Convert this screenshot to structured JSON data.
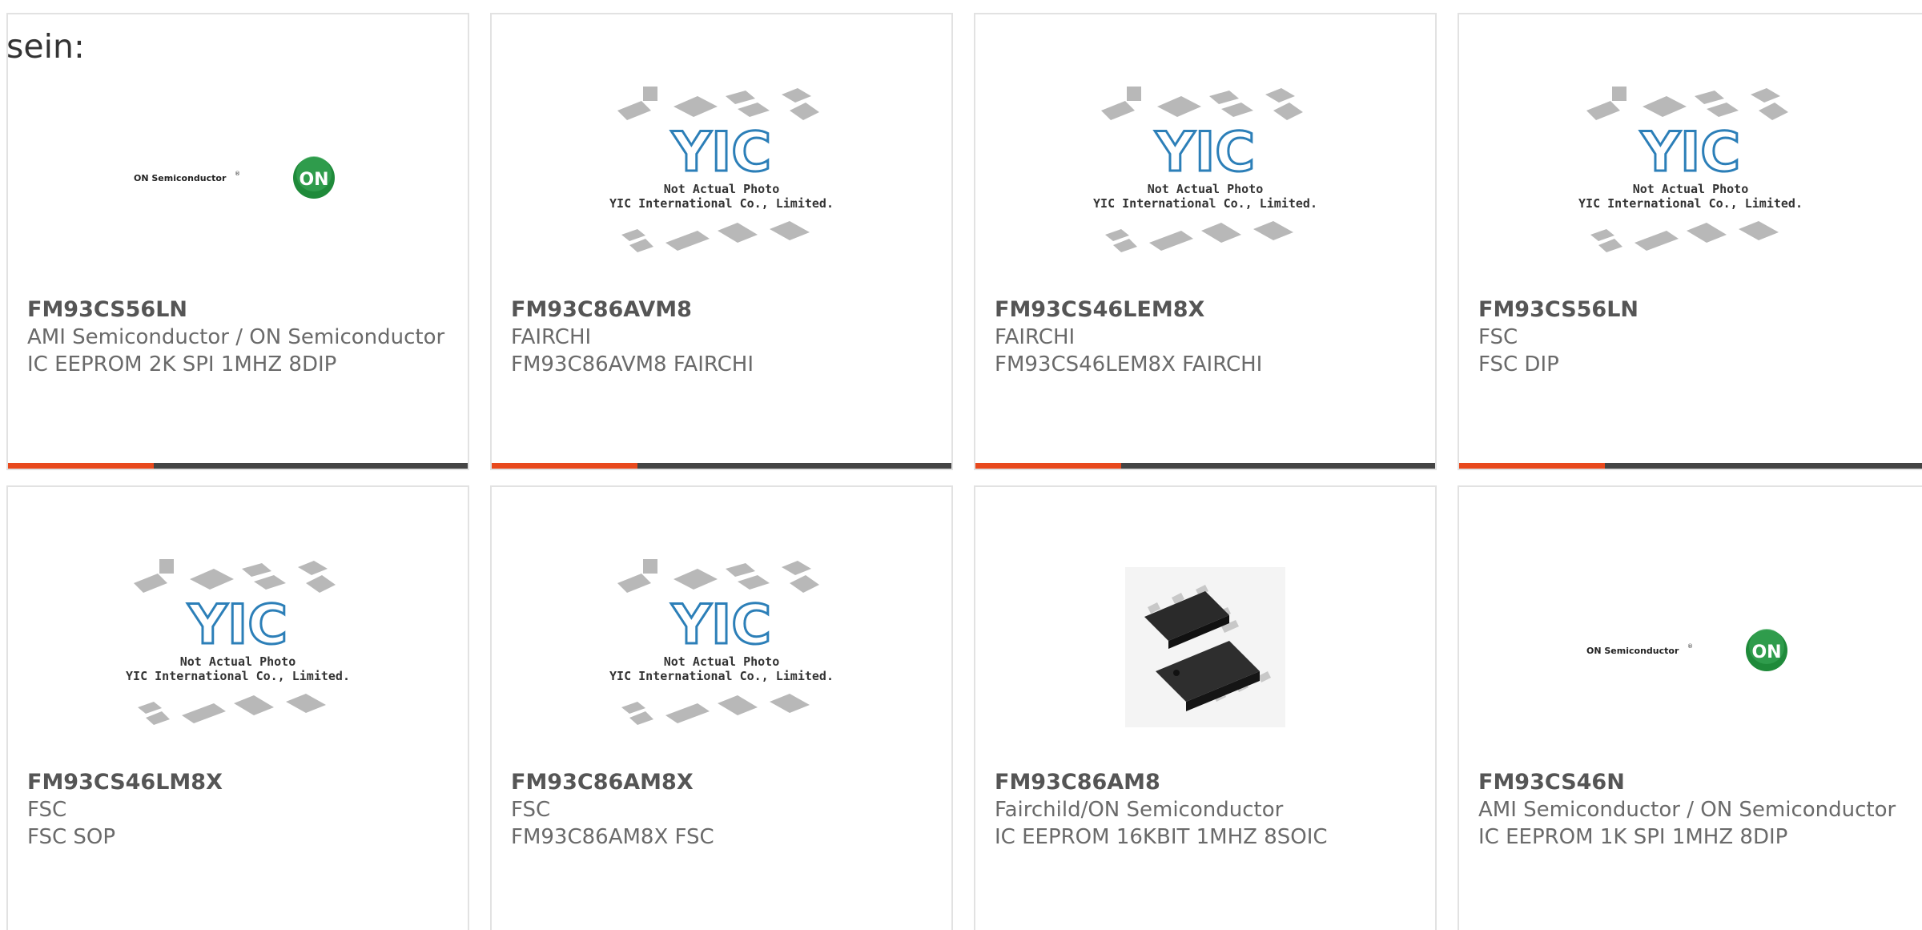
{
  "intro_text": "sein:",
  "colors": {
    "accent": "#e8491d",
    "bar": "#444444",
    "border": "#e2e2e2",
    "on_green": "#1f8a3a",
    "yic_blue": "#2c7fb8"
  },
  "placeholder": {
    "line1": "Not Actual Photo",
    "line2": "YIC International Co., Limited.",
    "logo": "YIC"
  },
  "on_logo": {
    "text": "ON Semiconductor",
    "badge": "ON"
  },
  "products": [
    {
      "part": "FM93CS56LN",
      "maker": "AMI Semiconductor / ON Semiconductor",
      "desc": "IC EEPROM 2K SPI 1MHZ 8DIP",
      "image": "on-semiconductor-logo"
    },
    {
      "part": "FM93C86AVM8",
      "maker": "FAIRCHI",
      "desc": "FM93C86AVM8 FAIRCHI",
      "image": "yic-placeholder"
    },
    {
      "part": "FM93CS46LEM8X",
      "maker": "FAIRCHI",
      "desc": "FM93CS46LEM8X FAIRCHI",
      "image": "yic-placeholder"
    },
    {
      "part": "FM93CS56LN",
      "maker": "FSC",
      "desc": "FSC DIP",
      "image": "yic-placeholder"
    },
    {
      "part": "FM93CS46LM8X",
      "maker": "FSC",
      "desc": "FSC SOP",
      "image": "yic-placeholder"
    },
    {
      "part": "FM93C86AM8X",
      "maker": "FSC",
      "desc": "FM93C86AM8X FSC",
      "image": "yic-placeholder"
    },
    {
      "part": "FM93C86AM8",
      "maker": "Fairchild/ON Semiconductor",
      "desc": "IC EEPROM 16KBIT 1MHZ 8SOIC",
      "image": "soic-chip-photo"
    },
    {
      "part": "FM93CS46N",
      "maker": "AMI Semiconductor / ON Semiconductor",
      "desc": "IC EEPROM 1K SPI 1MHZ 8DIP",
      "image": "on-semiconductor-logo"
    }
  ]
}
